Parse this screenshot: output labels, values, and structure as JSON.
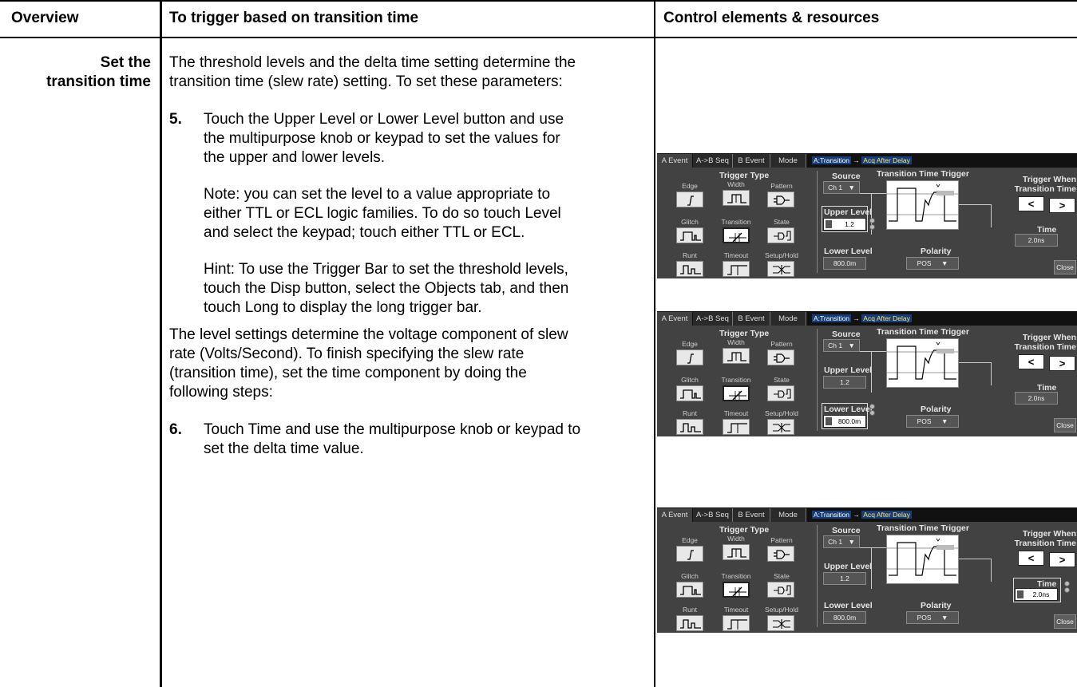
{
  "header": {
    "col1": "Overview",
    "col2": "To trigger based on transition time",
    "col3": "Control elements & resources"
  },
  "section": {
    "label_line1": "Set the",
    "label_line2": "transition time",
    "intro_line1": "The threshold levels and the delta time setting determine the",
    "intro_line2": "transition time (slew rate) setting. To set these parameters:",
    "step5_num": "5.",
    "step5_line1": "Touch the Upper Level or Lower Level button and use",
    "step5_line2": "the multipurpose knob or keypad to set the values for",
    "step5_line3": "the upper and lower levels.",
    "note_line1": "Note: you can set the level to a value appropriate to",
    "note_line2": "either TTL or ECL logic families. To do so touch Level",
    "note_line3": "and select the keypad; touch either TTL or ECL.",
    "hint_line1": "Hint: To use the Trigger Bar to set the threshold levels,",
    "hint_line2": "touch the Disp button, select the Objects tab, and then",
    "hint_line3": "touch Long to display the long trigger bar.",
    "level_line1": "The level settings determine the voltage component of slew",
    "level_line2": "rate (Volts/Second). To finish specifying the slew rate",
    "level_line3": "(transition time), set the time component by doing the",
    "level_line4": "following steps:",
    "step6_num": "6.",
    "step6_line1": "Touch Time and use the multipurpose knob or keypad to",
    "step6_line2": "set the delta time value."
  },
  "scope": {
    "tabs": [
      "A Event",
      "A->B Seq",
      "B Event",
      "Mode"
    ],
    "status_a": "A:Transition",
    "status_arrow": "→",
    "status_b": "Acq After Delay",
    "trigger_type_title": "Trigger Type",
    "types": [
      "Edge",
      "Width",
      "Pattern",
      "Glitch",
      "Transition",
      "State",
      "Runt",
      "Timeout",
      "Setup/Hold"
    ],
    "source_label": "Source",
    "source_value": "Ch 1",
    "graph_title": "Transition Time Trigger",
    "upper_label": "Upper Level",
    "upper_value": "1.2",
    "lower_label": "Lower Level",
    "lower_value": "800.0m",
    "polarity_label": "Polarity",
    "polarity_value": "POS",
    "trigger_when_1": "Trigger When",
    "trigger_when_2": "Transition Time",
    "lt_label": "<",
    "gt_label": ">",
    "time_label": "Time",
    "time_value": "2.0ns",
    "close_label": "Close",
    "dropdown_arrow": "▼"
  }
}
